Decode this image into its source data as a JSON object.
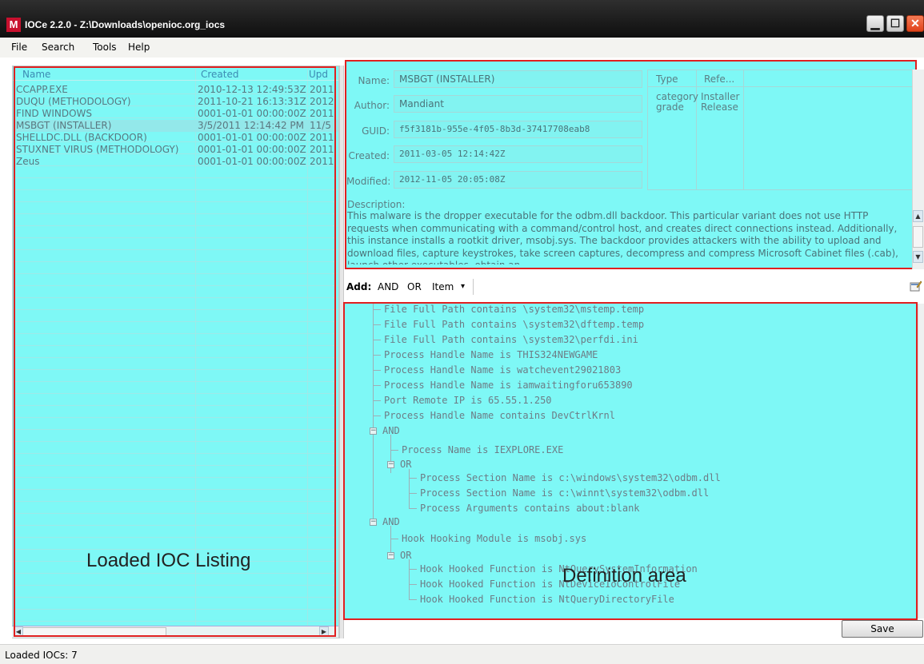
{
  "window": {
    "title": "IOCe 2.2.0 - Z:\\Downloads\\openioc.org_iocs",
    "app_icon_letter": "M",
    "minimize_glyph": "▁",
    "maximize_glyph": "☐",
    "close_glyph": "✕"
  },
  "menu": {
    "items": [
      {
        "label": "File"
      },
      {
        "label": "Search"
      },
      {
        "label": "Tools"
      },
      {
        "label": "Help"
      }
    ]
  },
  "ioc_list": {
    "columns": [
      "Name",
      "Created",
      "Upd"
    ],
    "rows": [
      {
        "name": "CCAPP.EXE",
        "created": "2010-12-13 12:49:53Z",
        "updated": "2011"
      },
      {
        "name": "DUQU (METHODOLOGY)",
        "created": "2011-10-21 16:13:31Z",
        "updated": "2012"
      },
      {
        "name": "FIND WINDOWS",
        "created": "0001-01-01 00:00:00Z",
        "updated": "2011"
      },
      {
        "name": "MSBGT (INSTALLER)",
        "created": "3/5/2011 12:14:42 PM",
        "updated": "11/5"
      },
      {
        "name": "SHELLDC.DLL (BACKDOOR)",
        "created": "0001-01-01 00:00:00Z",
        "updated": "2011"
      },
      {
        "name": "STUXNET VIRUS (METHODOLOGY)",
        "created": "0001-01-01 00:00:00Z",
        "updated": "2011"
      },
      {
        "name": "Zeus",
        "created": "0001-01-01 00:00:00Z",
        "updated": "2011"
      }
    ],
    "caption": "Loaded IOC Listing"
  },
  "details": {
    "name_label": "Name:",
    "name_value": "MSBGT (INSTALLER)",
    "author_label": "Author:",
    "author_value": "Mandiant",
    "guid_label": "GUID:",
    "guid_value": "f5f3181b-955e-4f05-8b3d-37417708eab8",
    "created_label": "Created:",
    "created_value": "2011-03-05 12:14:42Z",
    "modified_label": "Modified:",
    "modified_value": "2012-11-05 20:05:08Z",
    "params_header": [
      "Type",
      "Refe..."
    ],
    "params": [
      {
        "type": "category",
        "ref": "Installer"
      },
      {
        "type": "grade",
        "ref": "Release"
      }
    ],
    "description_label": "Description:",
    "description_text": "This malware is the dropper executable for the odbm.dll backdoor. This particular variant does not use HTTP requests when communicating with a command/control host, and creates direct connections instead.  Additionally, this instance installs a rootkit driver, msobj.sys. The backdoor provides attackers with the ability to upload and download files, capture keystrokes, take screen captures, decompress and compress Microsoft Cabinet files (.cab), launch other executables, obtain an"
  },
  "add_toolbar": {
    "add_label": "Add:",
    "and_label": "AND",
    "or_label": "OR",
    "item_label": "Item",
    "dropdown_glyph": "▾"
  },
  "definition": {
    "caption": "Definition area",
    "nodes": [
      {
        "text": "File Full Path contains \\system32\\mstemp.temp"
      },
      {
        "text": "File Full Path contains \\system32\\dftemp.temp"
      },
      {
        "text": "File Full Path contains \\system32\\perfdi.ini"
      },
      {
        "text": "Process Handle Name is THIS324NEWGAME"
      },
      {
        "text": "Process Handle Name is watchevent29021803"
      },
      {
        "text": "Process Handle Name is iamwaitingforu653890"
      },
      {
        "text": "Port Remote IP is 65.55.1.250"
      },
      {
        "text": "Process Handle Name contains DevCtrlKrnl"
      },
      {
        "text": "AND"
      },
      {
        "text": "Process Name is IEXPLORE.EXE"
      },
      {
        "text": "OR"
      },
      {
        "text": "Process Section Name is c:\\windows\\system32\\odbm.dll"
      },
      {
        "text": "Process Section Name is c:\\winnt\\system32\\odbm.dll"
      },
      {
        "text": "Process Arguments contains about:blank"
      },
      {
        "text": "AND"
      },
      {
        "text": "Hook Hooking Module is msobj.sys"
      },
      {
        "text": "OR"
      },
      {
        "text": "Hook Hooked Function is NtQuerySystemInformation"
      },
      {
        "text": "Hook Hooked Function is NtDeviceIoControlFile"
      },
      {
        "text": "Hook Hooked Function is NtQueryDirectoryFile"
      }
    ]
  },
  "save_label": "Save",
  "status": {
    "text": "Loaded IOCs: 7"
  }
}
